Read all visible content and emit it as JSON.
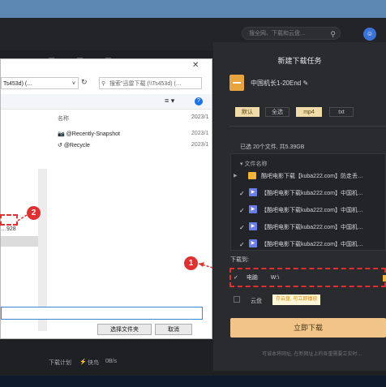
{
  "app": {
    "search_placeholder": "搜全网、下载和云盘…",
    "footer": {
      "plan_label": "下载计划",
      "fast_label": "快鸟",
      "speed": "0B/s"
    }
  },
  "dialog": {
    "path": "Ts453d) (…",
    "search": "搜索\"迅雷下载 (\\\\Ts453d) (…",
    "col_name": "名称",
    "col_date": "2023/1",
    "left_item": "…928",
    "files": [
      {
        "name": "@Recently-Snapshot",
        "date": "2023/1"
      },
      {
        "name": "@Recycle",
        "date": "2023/1"
      }
    ],
    "select_button": "选择文件夹",
    "cancel_button": "取消"
  },
  "annotations": {
    "badge1": "1",
    "badge2": "2"
  },
  "panel": {
    "title": "新建下载任务",
    "file_name": "中国机长1-20End",
    "formats": [
      "默认",
      "全选",
      "mp4",
      "txt"
    ],
    "selection_info": "已选 20个文件, 共5.39GB",
    "list_header": "文件名称",
    "rows": [
      {
        "type": "folder",
        "checked": false,
        "text": "酷吧电影下载【kuba222.com】防走丢…"
      },
      {
        "type": "video",
        "checked": true,
        "text": "【酷吧电影下载kuba222.com】中国机…"
      },
      {
        "type": "video",
        "checked": true,
        "text": "【酷吧电影下载kuba222.com】中国机…"
      },
      {
        "type": "video",
        "checked": true,
        "text": "【酷吧电影下载kuba222.com】中国机…"
      },
      {
        "type": "video",
        "checked": true,
        "text": "【酷吧电影下载kuba222.com】中国机…"
      }
    ],
    "download_to_label": "下载到:",
    "pc_label": "电脑",
    "pc_path": "W:\\",
    "cloud_label": "云盘",
    "cloud_tip": "存云盘, 可立即播放",
    "download_button": "立即下载",
    "note": "可诚本将网址, 在新网址上的各重需要立实时…"
  },
  "colors": {
    "accent": "#f1c587",
    "annotation_red": "#e03030",
    "link_blue": "#1a73e8"
  }
}
